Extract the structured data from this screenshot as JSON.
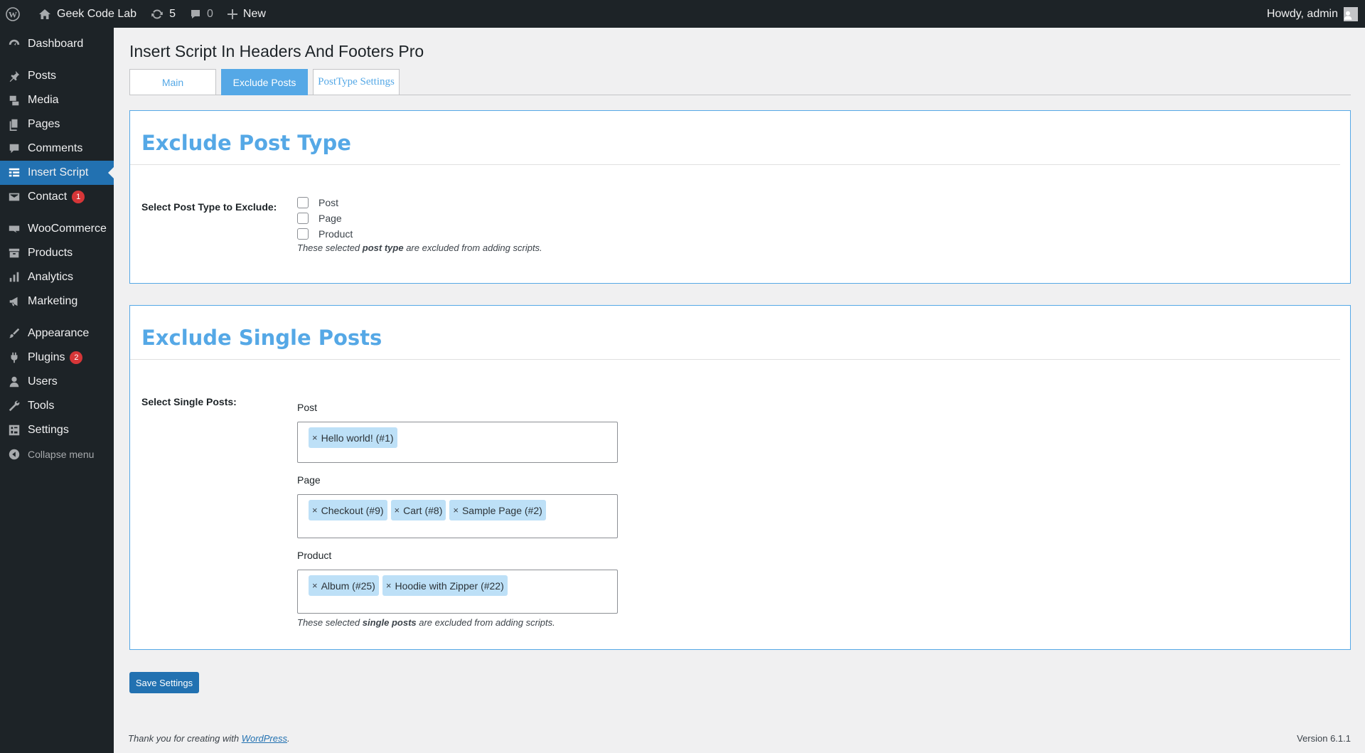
{
  "adminbar": {
    "site_name": "Geek Code Lab",
    "updates_count": "5",
    "comments_count": "0",
    "new_label": "New",
    "howdy": "Howdy, admin"
  },
  "sidebar": {
    "items": [
      {
        "label": "Dashboard",
        "icon": "dashboard-icon"
      },
      {
        "label": "Posts",
        "icon": "pin-icon"
      },
      {
        "label": "Media",
        "icon": "media-icon"
      },
      {
        "label": "Pages",
        "icon": "pages-icon"
      },
      {
        "label": "Comments",
        "icon": "comment-icon"
      },
      {
        "label": "Insert Script",
        "icon": "grid-icon",
        "active": true
      },
      {
        "label": "Contact",
        "icon": "mail-icon",
        "badge": "1"
      },
      {
        "label": "WooCommerce",
        "icon": "woo-icon"
      },
      {
        "label": "Products",
        "icon": "archive-icon"
      },
      {
        "label": "Analytics",
        "icon": "bar-chart-icon"
      },
      {
        "label": "Marketing",
        "icon": "megaphone-icon"
      },
      {
        "label": "Appearance",
        "icon": "brush-icon"
      },
      {
        "label": "Plugins",
        "icon": "plug-icon",
        "badge": "2"
      },
      {
        "label": "Users",
        "icon": "user-icon"
      },
      {
        "label": "Tools",
        "icon": "wrench-icon"
      },
      {
        "label": "Settings",
        "icon": "settings-icon"
      },
      {
        "label": "Collapse menu",
        "icon": "collapse-icon"
      }
    ]
  },
  "page": {
    "title": "Insert Script In Headers And Footers Pro",
    "tabs": [
      "Main",
      "Exclude Posts",
      "PostType Settings"
    ],
    "active_tab": "Exclude Posts"
  },
  "exclude_post_type": {
    "heading": "Exclude Post Type",
    "label": "Select Post Type to Exclude:",
    "options": [
      {
        "label": "Post",
        "checked": false
      },
      {
        "label": "Page",
        "checked": false
      },
      {
        "label": "Product",
        "checked": false
      }
    ],
    "desc_pre": "These selected ",
    "desc_bold": "post type",
    "desc_post": " are excluded from adding scripts."
  },
  "exclude_single_posts": {
    "heading": "Exclude Single Posts",
    "label": "Select Single Posts:",
    "groups": [
      {
        "label": "Post",
        "chips": [
          "Hello world! (#1)"
        ]
      },
      {
        "label": "Page",
        "chips": [
          "Checkout (#9)",
          "Cart (#8)",
          "Sample Page (#2)"
        ]
      },
      {
        "label": "Product",
        "chips": [
          "Album (#25)",
          "Hoodie with Zipper (#22)"
        ]
      }
    ],
    "desc_pre": "These selected ",
    "desc_bold": "single posts",
    "desc_post": " are excluded from adding scripts."
  },
  "save_label": "Save Settings",
  "footer": {
    "thanks_pre": "Thank you for creating with ",
    "link": "WordPress",
    "thanks_post": ".",
    "version": "Version 6.1.1"
  },
  "colors": {
    "accent": "#55a8e6",
    "wp_blue": "#2271b1",
    "chip_bg": "#bde0f7",
    "badge_red": "#d63638",
    "sidebar_bg": "#1d2327"
  }
}
